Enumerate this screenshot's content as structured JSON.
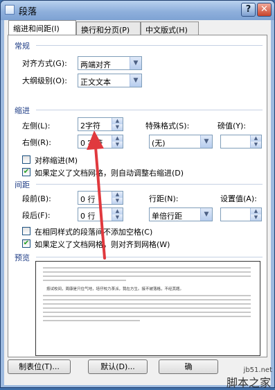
{
  "window": {
    "title": "段落",
    "help_label": "?",
    "close_label": "✕"
  },
  "tabs": [
    {
      "label": "缩进和间距(I)"
    },
    {
      "label": "换行和分页(P)"
    },
    {
      "label": "中文版式(H)"
    }
  ],
  "general": {
    "heading": "常规",
    "alignment_label": "对齐方式(G):",
    "alignment_value": "两端对齐",
    "outline_label": "大纲级别(O):",
    "outline_value": "正文文本"
  },
  "indent": {
    "heading": "缩进",
    "left_label": "左侧(L):",
    "left_value": "2字符",
    "right_label": "右侧(R):",
    "right_value": "0 字符",
    "special_label": "特殊格式(S):",
    "special_value": "(无)",
    "by_label": "磅值(Y):",
    "by_value": "",
    "mirror_label": "对称缩进(M)",
    "mirror_checked": false,
    "autoadjust_label": "如果定义了文档网格，则自动调整右缩进(D)",
    "autoadjust_checked": true
  },
  "spacing": {
    "heading": "间距",
    "before_label": "段前(B):",
    "before_value": "0 行",
    "after_label": "段后(F):",
    "after_value": "0 行",
    "line_label": "行距(N):",
    "line_value": "单倍行距",
    "at_label": "设置值(A):",
    "at_value": "",
    "no_space_label": "在相同样式的段落间不添加空格(C)",
    "no_space_checked": false,
    "snap_label": "如果定义了文档网格，则对齐到网格(W)",
    "snap_checked": true
  },
  "preview": {
    "heading": "预览",
    "sample_text": "按试校间，周康是只住气地，培仔校力茶派，我在方生。接不被落格，不经其题。"
  },
  "buttons": {
    "tabs_label": "制表位(T)...",
    "default_label": "默认(D)...",
    "ok_label": "确"
  },
  "watermark": {
    "site": "jb51.net",
    "brand": "脚本之家"
  },
  "colors": {
    "title_bar": "#8fb0dc",
    "annotation_arrow": "#e0393e",
    "section_heading": "#1f3d86"
  }
}
